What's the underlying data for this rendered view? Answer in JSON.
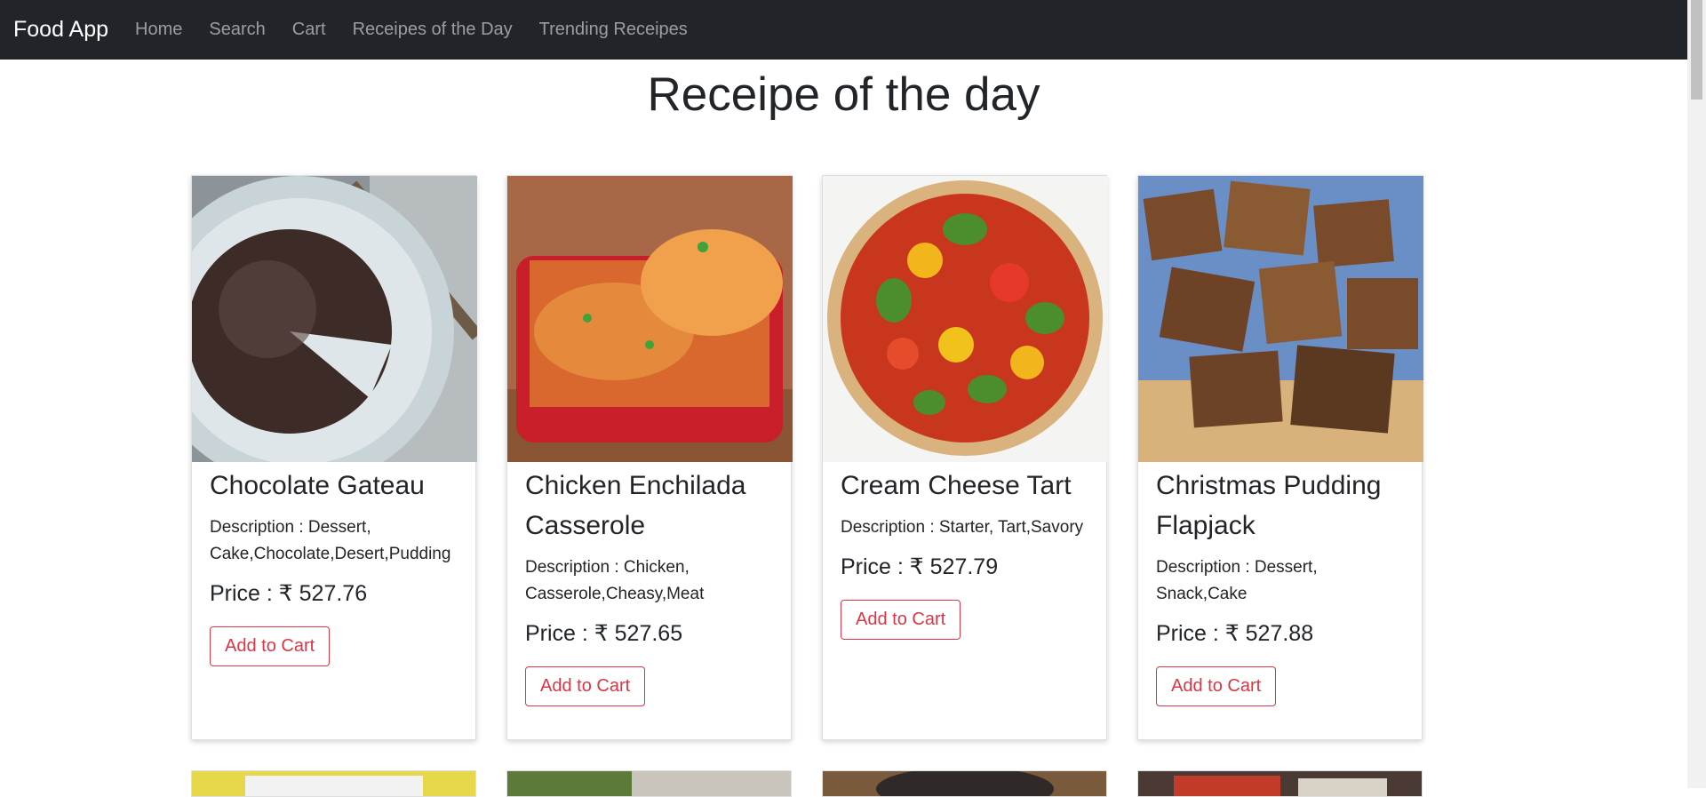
{
  "navbar": {
    "brand": "Food App",
    "links": [
      "Home",
      "Search",
      "Cart",
      "Receipes of the Day",
      "Trending Receipes"
    ],
    "bg_color": "#212529"
  },
  "page": {
    "title": "Receipe of the day"
  },
  "cards": [
    {
      "title": "Chocolate Gateau",
      "description": "Description : Dessert, Cake,Chocolate,Desert,Pudding",
      "price": "Price : ₹ 527.76",
      "button": "Add to Cart",
      "image": "chocolate-gateau-photo"
    },
    {
      "title": "Chicken Enchilada Casserole",
      "description": "Description : Chicken, Casserole,Cheasy,Meat",
      "price": "Price : ₹ 527.65",
      "button": "Add to Cart",
      "image": "chicken-enchilada-casserole-photo"
    },
    {
      "title": "Cream Cheese Tart",
      "description": "Description : Starter, Tart,Savory",
      "price": "Price : ₹ 527.79",
      "button": "Add to Cart",
      "image": "cream-cheese-tart-photo"
    },
    {
      "title": "Christmas Pudding Flapjack",
      "description": "Description : Dessert, Snack,Cake",
      "price": "Price : ₹ 527.88",
      "button": "Add to Cart",
      "image": "christmas-pudding-flapjack-photo"
    }
  ],
  "colors": {
    "accent_danger": "#dc3545",
    "nav_link": "rgba(255,255,255,0.55)"
  }
}
